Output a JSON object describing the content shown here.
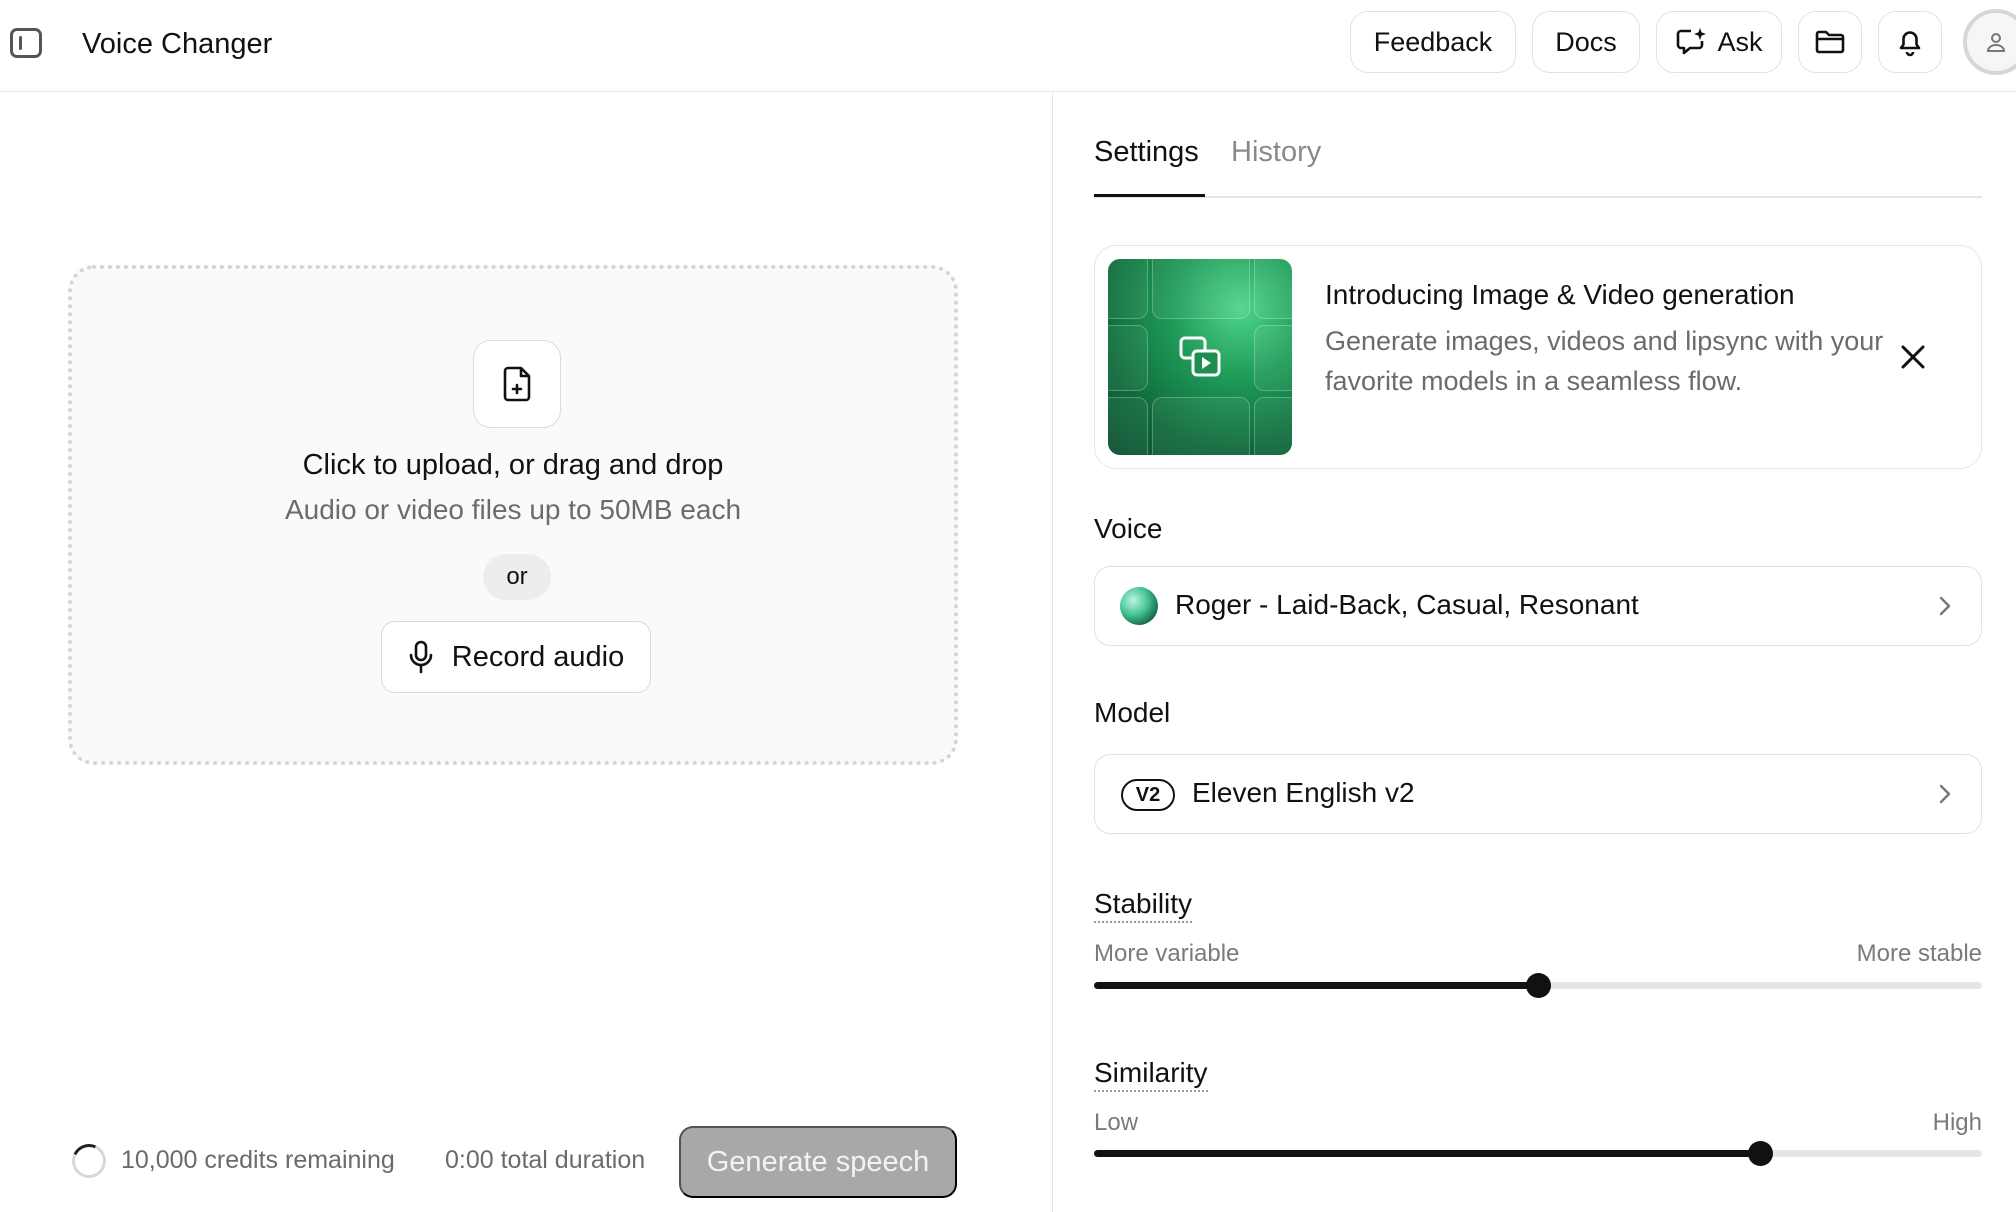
{
  "header": {
    "title": "Voice Changer",
    "buttons": {
      "feedback": "Feedback",
      "docs": "Docs",
      "ask": "Ask"
    },
    "icons": [
      "sidebar-toggle-icon",
      "sparkle-chat-icon",
      "folder-icon",
      "bell-icon",
      "user-icon"
    ]
  },
  "upload": {
    "title": "Click to upload, or drag and drop",
    "subtitle": "Audio or video files up to 50MB each",
    "or": "or",
    "record": "Record audio"
  },
  "footer": {
    "credits": "10,000 credits remaining",
    "duration": "0:00 total duration",
    "generate": "Generate speech"
  },
  "tabs": {
    "settings": "Settings",
    "history": "History",
    "active": "settings"
  },
  "promo": {
    "title": "Introducing Image & Video generation",
    "text": "Generate images, videos and lipsync with your favorite models in a seamless flow."
  },
  "voice": {
    "label": "Voice",
    "value": "Roger - Laid-Back, Casual, Resonant"
  },
  "model": {
    "label": "Model",
    "badge": "V2",
    "value": "Eleven English v2"
  },
  "stability": {
    "label": "Stability",
    "min_label": "More variable",
    "max_label": "More stable",
    "value": 0.5
  },
  "similarity": {
    "label": "Similarity",
    "min_label": "Low",
    "max_label": "High",
    "value": 0.75
  },
  "colors": {
    "accent": "#111111",
    "muted_text": "#6b6b6b",
    "disabled_button": "#a8a8a8",
    "promo_green": "#1f9b58"
  }
}
